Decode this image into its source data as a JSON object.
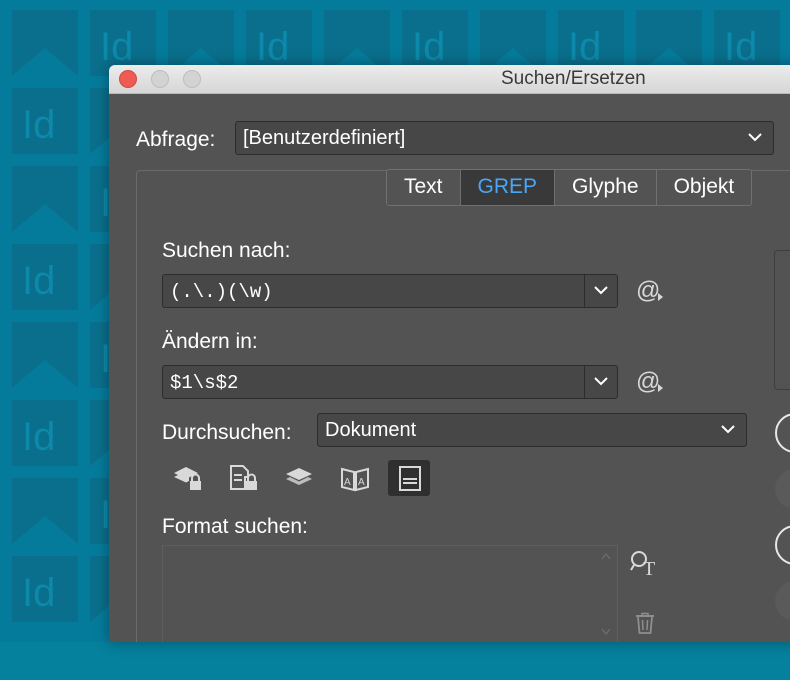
{
  "window": {
    "title": "Suchen/Ersetzen"
  },
  "query": {
    "label": "Abfrage:",
    "value": "[Benutzerdefiniert]"
  },
  "tabs": [
    {
      "label": "Text",
      "active": false
    },
    {
      "label": "GREP",
      "active": true
    },
    {
      "label": "Glyphe",
      "active": false
    },
    {
      "label": "Objekt",
      "active": false
    }
  ],
  "search": {
    "label": "Suchen nach:",
    "value": "(.\\.)(\\w)"
  },
  "replace": {
    "label": "Ändern in:",
    "value": "$1\\s$2"
  },
  "scope": {
    "label": "Durchsuchen:",
    "value": "Dokument"
  },
  "format_search": {
    "label": "Format suchen:"
  },
  "option_icons": [
    "locked-layers-icon",
    "locked-stories-icon",
    "hidden-layers-icon",
    "master-pages-icon",
    "footnotes-icon"
  ],
  "colors": {
    "desktop": "#057b9b",
    "dialog": "#535353",
    "active_tab_text": "#4ba6f5",
    "close_button": "#ee5b55"
  }
}
